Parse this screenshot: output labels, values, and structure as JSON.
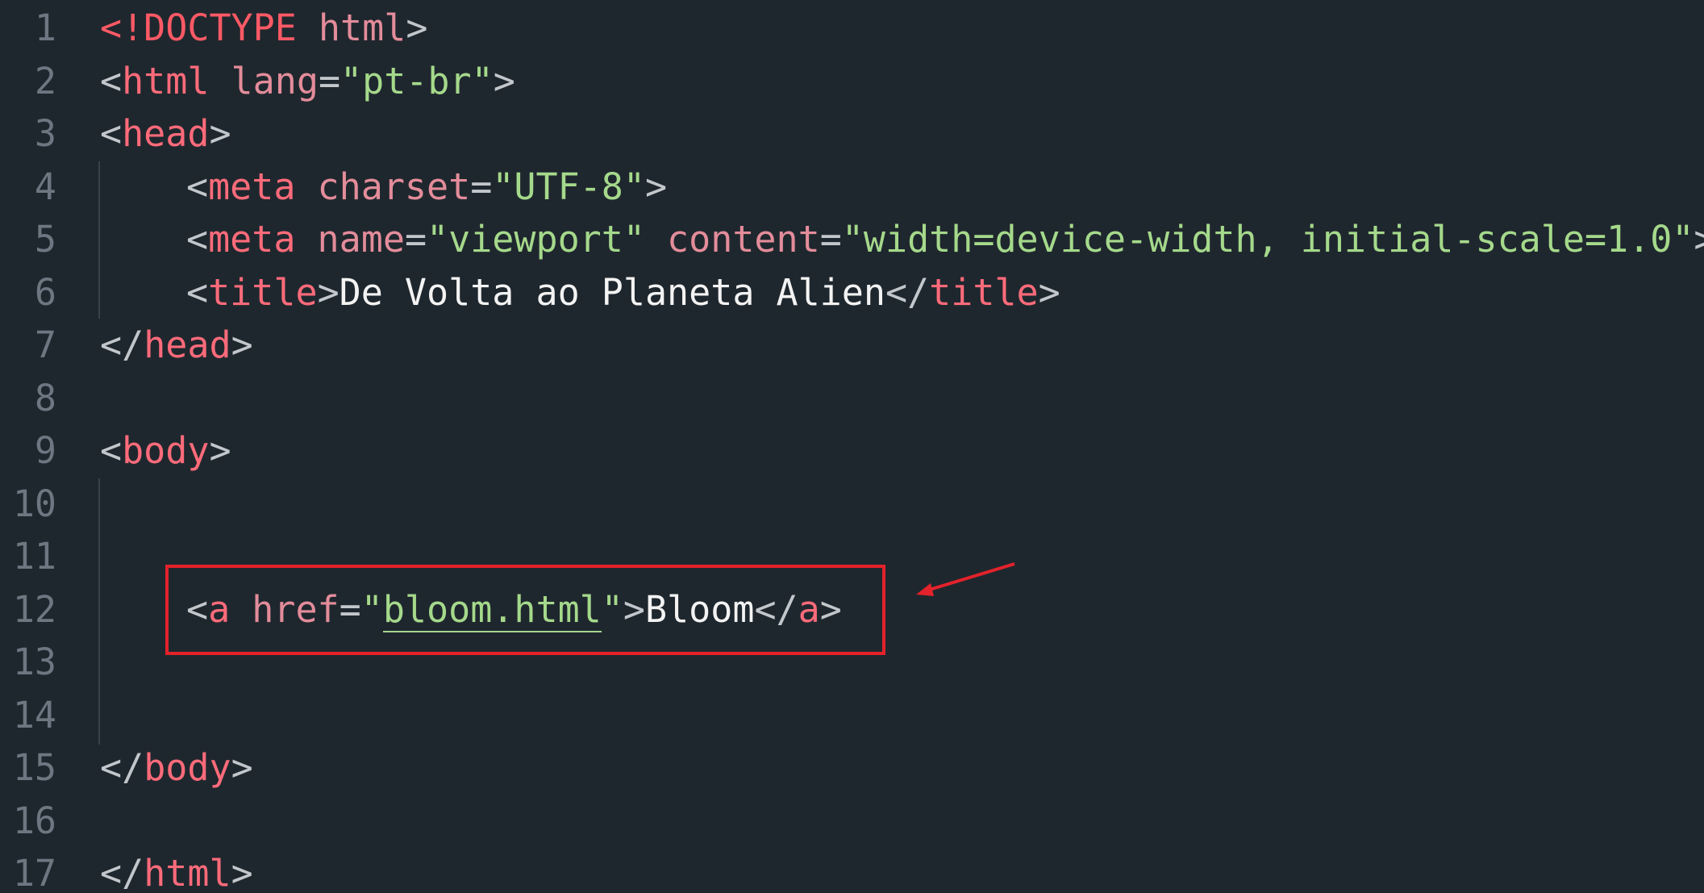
{
  "editor": {
    "lines": [
      {
        "num": "1",
        "parts": [
          {
            "t": "<!DOCTYPE",
            "c": "doctype"
          },
          {
            "t": " html",
            "c": "attr"
          },
          {
            "t": ">",
            "c": "punct"
          }
        ]
      },
      {
        "num": "2",
        "parts": [
          {
            "t": "<",
            "c": "punct"
          },
          {
            "t": "html",
            "c": "tag"
          },
          {
            "t": " lang",
            "c": "attr"
          },
          {
            "t": "=",
            "c": "eq"
          },
          {
            "t": "\"pt-br\"",
            "c": "str"
          },
          {
            "t": ">",
            "c": "punct"
          }
        ]
      },
      {
        "num": "3",
        "parts": [
          {
            "t": "<",
            "c": "punct"
          },
          {
            "t": "head",
            "c": "tag"
          },
          {
            "t": ">",
            "c": "punct"
          }
        ]
      },
      {
        "num": "4",
        "parts": [
          {
            "t": "<",
            "c": "punct"
          },
          {
            "t": "meta",
            "c": "tag"
          },
          {
            "t": " charset",
            "c": "attr"
          },
          {
            "t": "=",
            "c": "eq"
          },
          {
            "t": "\"UTF-8\"",
            "c": "str"
          },
          {
            "t": ">",
            "c": "punct"
          }
        ]
      },
      {
        "num": "5",
        "parts": [
          {
            "t": "<",
            "c": "punct"
          },
          {
            "t": "meta",
            "c": "tag"
          },
          {
            "t": " name",
            "c": "attr"
          },
          {
            "t": "=",
            "c": "eq"
          },
          {
            "t": "\"viewport\"",
            "c": "str"
          },
          {
            "t": " content",
            "c": "attr"
          },
          {
            "t": "=",
            "c": "eq"
          },
          {
            "t": "\"width=device-width, initial-scale=1.0\"",
            "c": "str"
          },
          {
            "t": ">",
            "c": "punct"
          }
        ]
      },
      {
        "num": "6",
        "parts": [
          {
            "t": "<",
            "c": "punct"
          },
          {
            "t": "title",
            "c": "tag"
          },
          {
            "t": ">",
            "c": "punct"
          },
          {
            "t": "De Volta ao Planeta Alien",
            "c": "text"
          },
          {
            "t": "</",
            "c": "punct"
          },
          {
            "t": "title",
            "c": "tag"
          },
          {
            "t": ">",
            "c": "punct"
          }
        ]
      },
      {
        "num": "7",
        "parts": [
          {
            "t": "</",
            "c": "punct"
          },
          {
            "t": "head",
            "c": "tag"
          },
          {
            "t": ">",
            "c": "punct"
          }
        ]
      },
      {
        "num": "8",
        "parts": []
      },
      {
        "num": "9",
        "parts": [
          {
            "t": "<",
            "c": "punct"
          },
          {
            "t": "body",
            "c": "tag"
          },
          {
            "t": ">",
            "c": "punct"
          }
        ]
      },
      {
        "num": "10",
        "parts": []
      },
      {
        "num": "11",
        "parts": []
      },
      {
        "num": "12",
        "parts": [
          {
            "t": "<",
            "c": "punct"
          },
          {
            "t": "a",
            "c": "tag"
          },
          {
            "t": " href",
            "c": "attr"
          },
          {
            "t": "=",
            "c": "eq"
          },
          {
            "t": "\"",
            "c": "str"
          },
          {
            "t": "bloom.html",
            "c": "str-link"
          },
          {
            "t": "\"",
            "c": "str"
          },
          {
            "t": ">",
            "c": "punct"
          },
          {
            "t": "Bloom",
            "c": "text"
          },
          {
            "t": "</",
            "c": "punct"
          },
          {
            "t": "a",
            "c": "tag"
          },
          {
            "t": ">",
            "c": "punct"
          }
        ]
      },
      {
        "num": "13",
        "parts": []
      },
      {
        "num": "14",
        "parts": []
      },
      {
        "num": "15",
        "parts": [
          {
            "t": "</",
            "c": "punct"
          },
          {
            "t": "body",
            "c": "tag"
          },
          {
            "t": ">",
            "c": "punct"
          }
        ]
      },
      {
        "num": "16",
        "parts": []
      },
      {
        "num": "17",
        "parts": [
          {
            "t": "</",
            "c": "punct"
          },
          {
            "t": "html",
            "c": "tag"
          },
          {
            "t": ">",
            "c": "punct"
          }
        ]
      }
    ]
  },
  "annotation": {
    "box_color": "#e3222b",
    "arrow_color": "#e3222b",
    "highlighted_line": "12"
  }
}
